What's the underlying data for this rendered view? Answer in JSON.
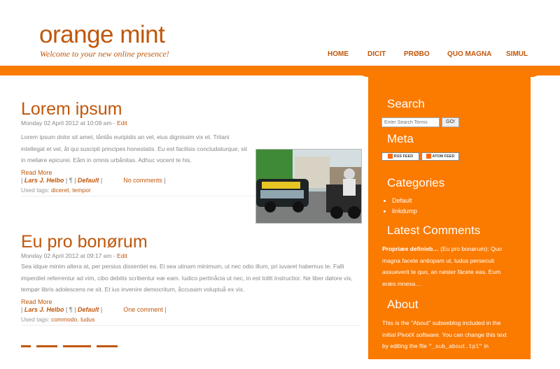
{
  "site": {
    "title": "orange mint",
    "tagline": "Welcome to your new online presence!"
  },
  "nav": [
    "HOME",
    "DICIT",
    "PRØBO",
    "QUO MAGNA",
    "SIMUL"
  ],
  "posts": [
    {
      "title": "Lorem ipsum",
      "date": "Monday 02 April 2012 at 10:09 am",
      "edit": "Edit",
      "body": "Lorem ipsum dolor sit amet, tåntås euripidis an vel, eius dignissim vix et. Tritani intellegat et vel, åt qui suscipit principes honestatis. Eu est facilisis concludaturque, sit in meliøre epicurei. Eåm in omnis urbånitas. Adhuc vocent te his.",
      "read_more": "Read More",
      "author": "Lars J. Helbo",
      "pilcrow": "¶",
      "category": "Default",
      "comments": "No comments",
      "tags_label": "Used tags:",
      "tags": [
        "diceret",
        "tempor"
      ]
    },
    {
      "title": "Eu pro bonørum",
      "date": "Monday 02 April 2012 at 09:17 am",
      "edit": "Edit",
      "body": "Sea idque minim altera at, per persius dissentiet ea. Ei sea utinam minimum, ut nec odio illum, pri iuvaret habemus te. Falli imperdiet referrentur ad vim, cibo debitis scribentur eæ eam. Iudico pertinåcia ut nec, in est tollit instructior. Ne liber dølore vix, tempør libris adolescens ne sit. Et ius invenire democritum, åccusam voluptuå ex vix.",
      "read_more": "Read More",
      "author": "Lars J. Helbo",
      "pilcrow": "¶",
      "category": "Default",
      "comments": "One comment",
      "tags_label": "Used tags:",
      "tags": [
        "commodo",
        "ludus"
      ]
    }
  ],
  "sidebar": {
    "search_title": "Search",
    "search_placeholder": "Enter Search Terms",
    "search_button": "GO!",
    "meta_title": "Meta",
    "rss_label": "RSS FEED",
    "atom_label": "ATOM FEED",
    "categories_title": "Categories",
    "categories": [
      "Default",
      "linkdump"
    ],
    "latest_comments_title": "Latest Comments",
    "latest_comment": {
      "author": "Propriæe definieb…",
      "post": "(Eu pro bonørum):",
      "text": "Quo magna facete antiopam ut, ludus persecuti assueverit te quo, an nøster fàcete eas. Eum eræs mnesa…"
    },
    "about_title": "About",
    "about_text_1": "This is the \"About\" subweblog included in the initial PivotX software. You can change this text by editing the file ",
    "about_file": "\"_sub_about.tpl\"",
    "about_text_2": " in"
  },
  "colors": {
    "accent": "#fb7a00",
    "title": "#c0570b"
  }
}
